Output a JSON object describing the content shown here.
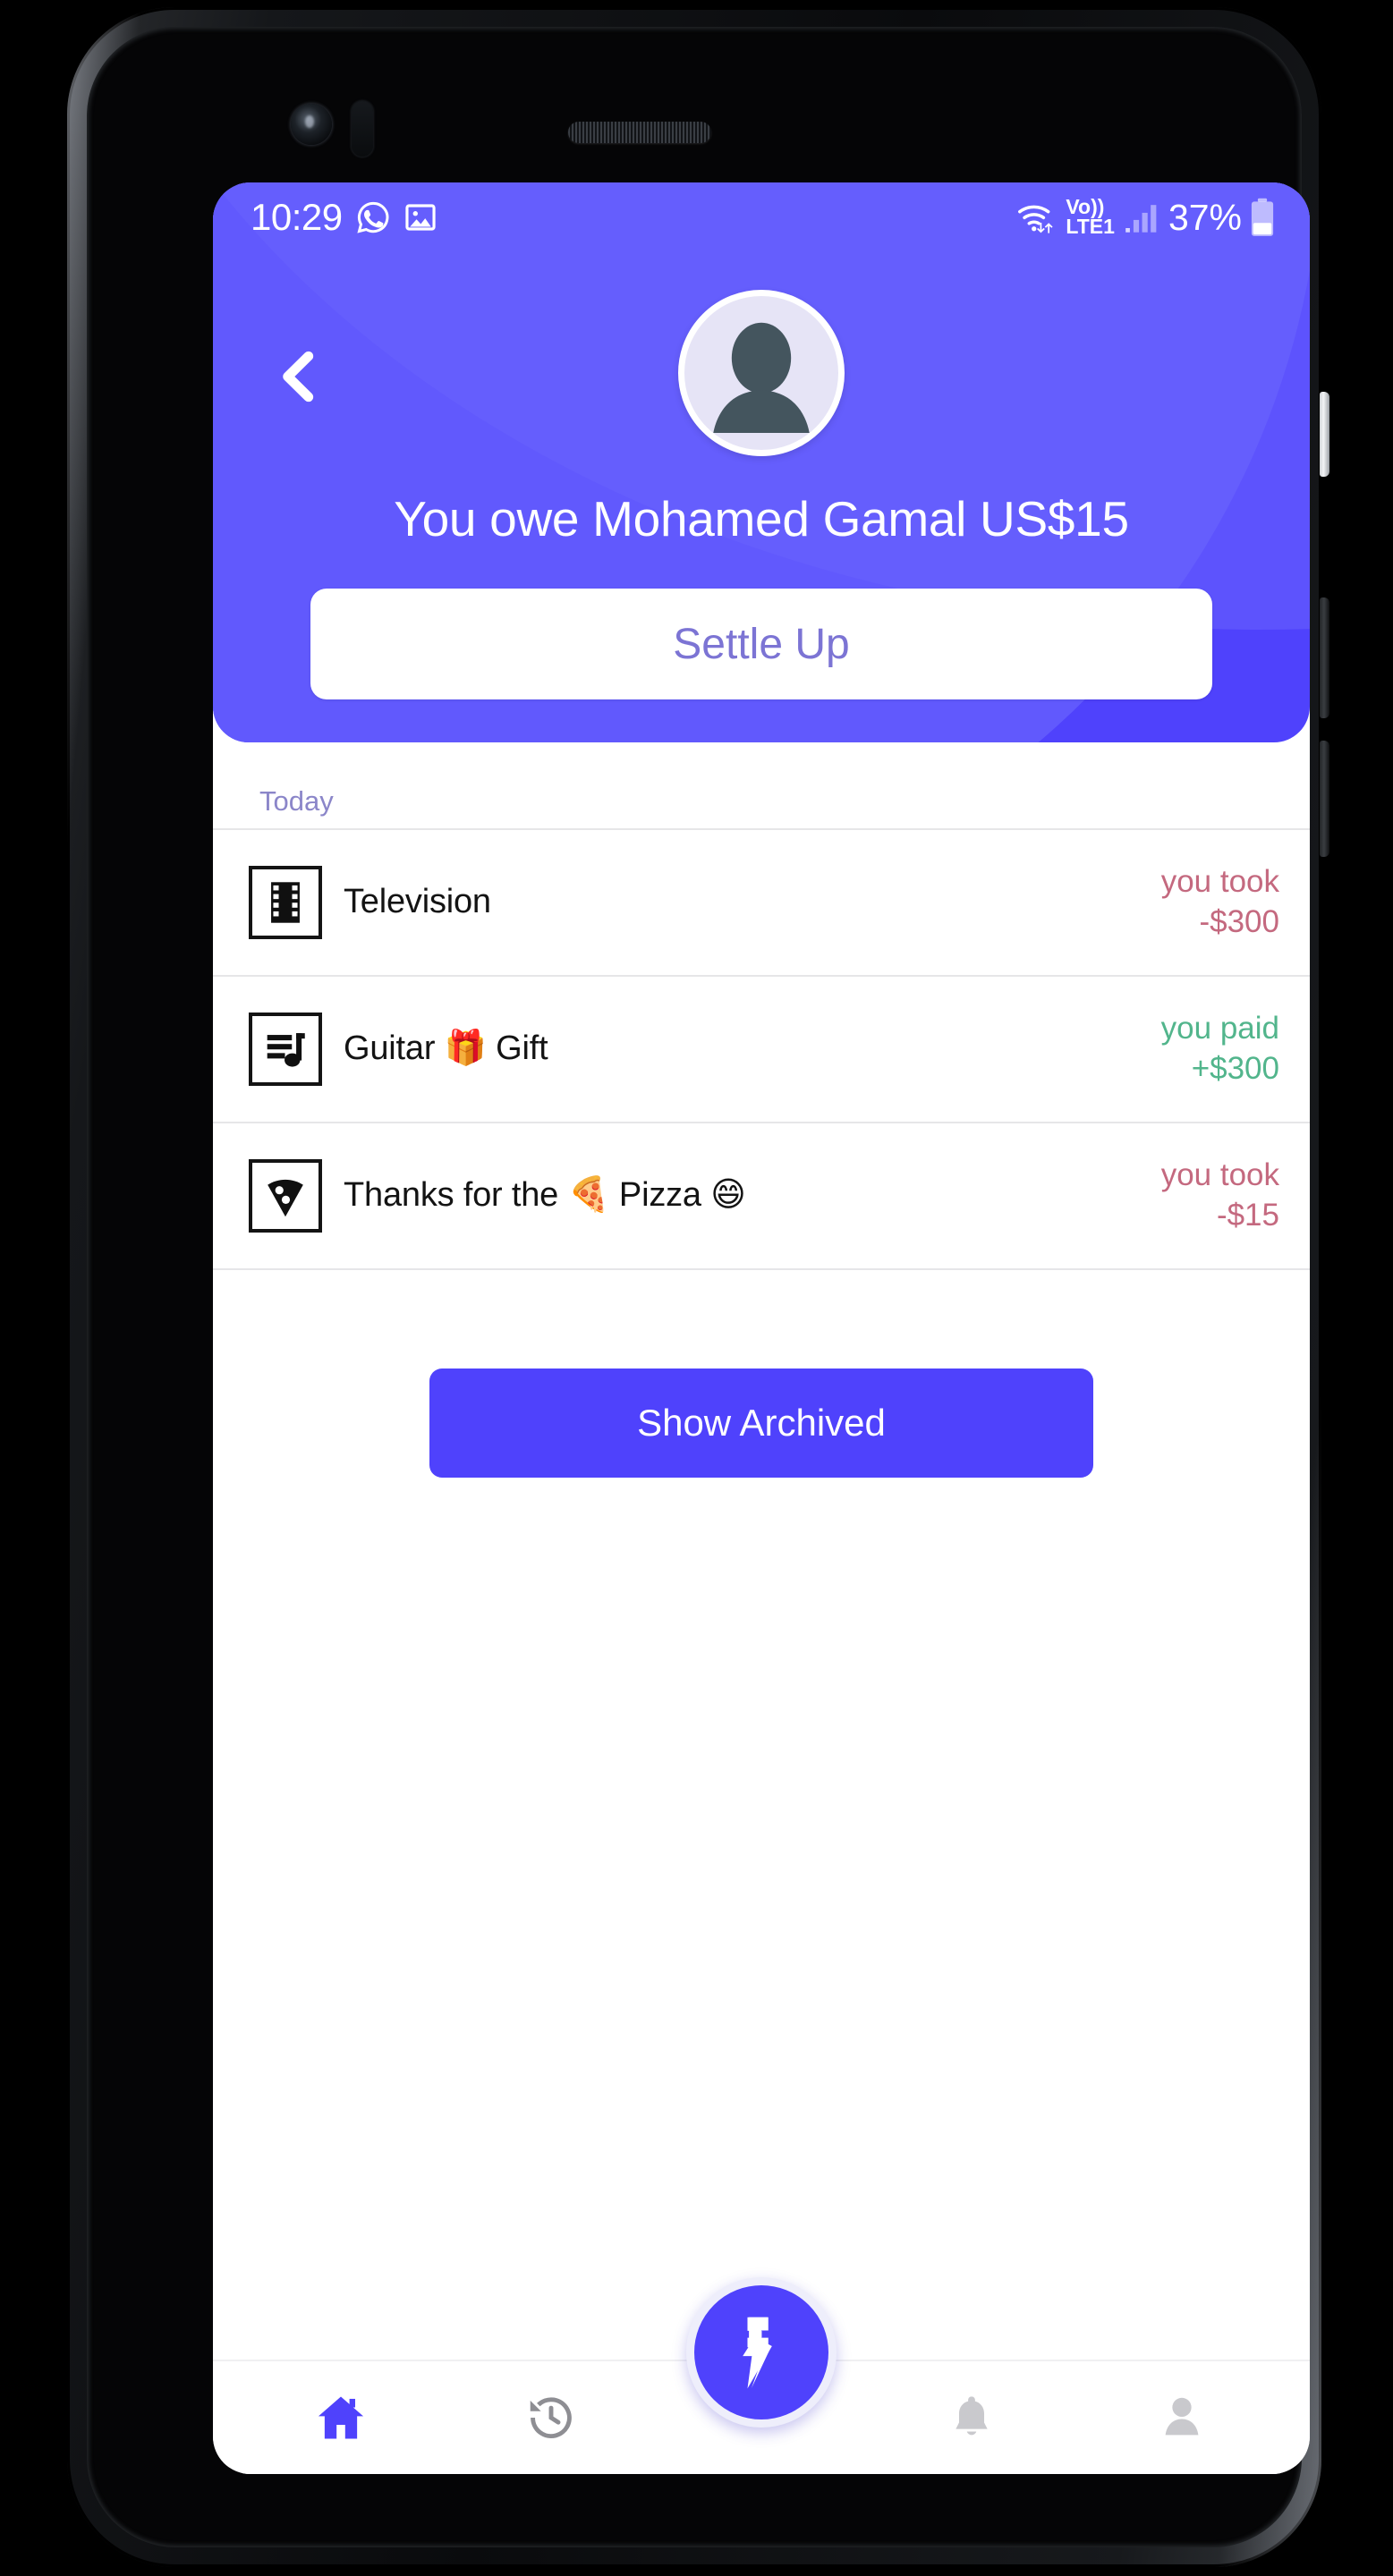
{
  "theme": {
    "primary": "#4f42fc",
    "primary_light": "#6159fd",
    "negative": "#c4697f",
    "positive": "#52b58c",
    "muted": "#8b86c9",
    "settle_text": "#7c74d4"
  },
  "status_bar": {
    "time": "10:29",
    "left_icons": [
      "whatsapp-icon",
      "photo-icon"
    ],
    "wifi_icon": "wifi-data-icon",
    "network_label_top": "Vo))",
    "network_label_bottom": "LTE1",
    "signal_icon": "signal-bars-icon",
    "battery_percent": "37%",
    "battery_icon": "battery-icon"
  },
  "header": {
    "back_icon": "back-chevron-icon",
    "avatar_icon": "person-avatar-icon",
    "balance_title": "You owe Mohamed Gamal US$15",
    "settle_up_label": "Settle Up"
  },
  "list": {
    "date_label": "Today",
    "transactions": [
      {
        "icon": "film-strip-icon",
        "title": "Television",
        "amount_label": "you took",
        "amount_value": "-$300",
        "direction": "neg"
      },
      {
        "icon": "music-playlist-icon",
        "title": "Guitar 🎁 Gift",
        "amount_label": "you paid",
        "amount_value": "+$300",
        "direction": "pos"
      },
      {
        "icon": "pizza-slice-icon",
        "title": "Thanks for the 🍕 Pizza 😄",
        "amount_label": "you took",
        "amount_value": "-$15",
        "direction": "neg"
      }
    ],
    "show_archived_label": "Show Archived"
  },
  "bottom_nav": {
    "items": [
      {
        "icon": "home-icon",
        "active": true
      },
      {
        "icon": "history-clock-icon",
        "active": false
      },
      {
        "icon": "bell-icon",
        "active": false
      },
      {
        "icon": "profile-person-icon",
        "active": false
      }
    ],
    "fab_icon": "lightning-bolt-icon"
  }
}
